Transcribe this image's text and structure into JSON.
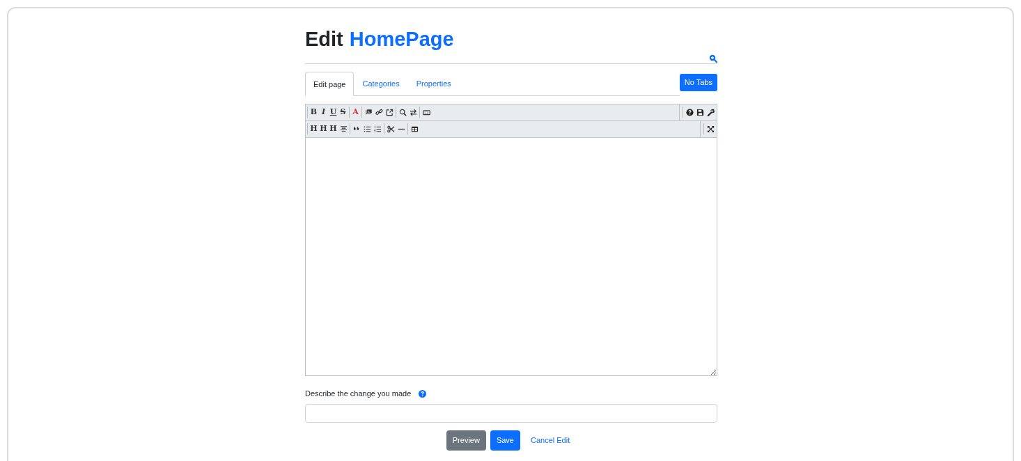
{
  "title": {
    "prefix": "Edit",
    "page": "HomePage"
  },
  "tabs": [
    {
      "label": "Edit page",
      "selected": true
    },
    {
      "label": "Categories",
      "selected": false
    },
    {
      "label": "Properties",
      "selected": false
    }
  ],
  "no_tabs_button": "No Tabs",
  "toolbar": [
    {
      "left": [
        [
          {
            "kind": "letter",
            "text": "B"
          },
          {
            "kind": "letter",
            "text": "I"
          },
          {
            "kind": "letter",
            "text": "U"
          },
          {
            "kind": "letter",
            "text": "S"
          }
        ],
        [
          {
            "kind": "letter",
            "text": "A",
            "color": "#dc3545"
          }
        ],
        [
          {
            "kind": "icon"
          },
          {
            "kind": "icon"
          },
          {
            "kind": "icon"
          }
        ],
        [
          {
            "kind": "icon"
          },
          {
            "kind": "icon"
          }
        ],
        [
          {
            "kind": "icon"
          }
        ]
      ],
      "right": [
        [
          {
            "kind": "icon"
          },
          {
            "kind": "icon"
          },
          {
            "kind": "icon"
          }
        ]
      ]
    },
    {
      "left": [
        [
          {
            "kind": "letter",
            "text": "H"
          },
          {
            "kind": "letter",
            "text": "H"
          },
          {
            "kind": "letter",
            "text": "H"
          },
          {
            "kind": "icon"
          }
        ],
        [
          {
            "kind": "icon"
          },
          {
            "kind": "icon"
          },
          {
            "kind": "icon"
          }
        ],
        [
          {
            "kind": "icon"
          },
          {
            "kind": "icon"
          }
        ],
        [
          {
            "kind": "icon"
          }
        ]
      ],
      "right": [
        [
          {
            "kind": "icon"
          }
        ]
      ]
    }
  ],
  "change_label": "Describe the change you made",
  "buttons": [
    {
      "label": "Preview",
      "kind": "secondary"
    },
    {
      "label": "Save",
      "kind": "primary"
    },
    {
      "label": "Cancel Edit",
      "kind": "link"
    }
  ]
}
